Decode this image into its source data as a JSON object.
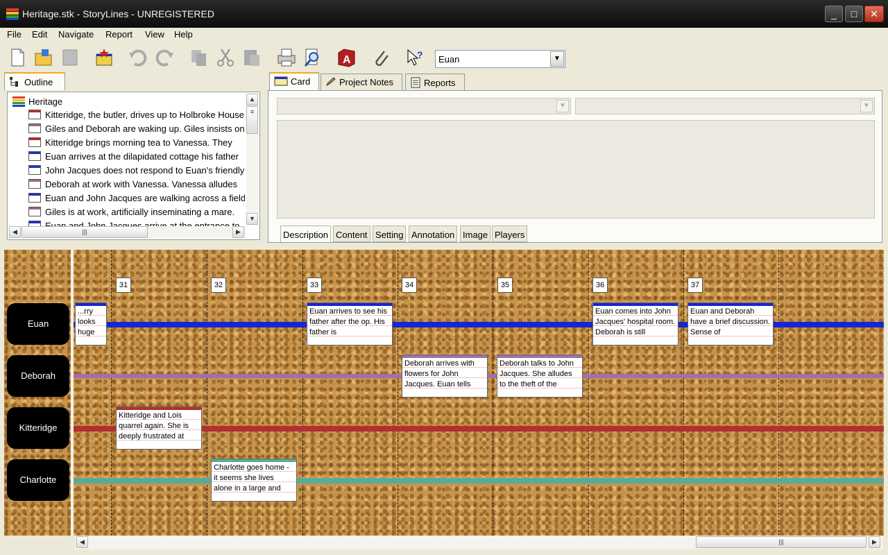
{
  "window": {
    "title": "Heritage.stk - StoryLines - UNREGISTERED",
    "minimize": "_",
    "maximize": "□",
    "close": "✕"
  },
  "menu": [
    "File",
    "Edit",
    "Navigate",
    "Report",
    "View",
    "Help"
  ],
  "toolbar": {
    "character_select": "Euan"
  },
  "outline": {
    "tab_label": "Outline",
    "root": "Heritage",
    "items": [
      {
        "text": "Kitteridge, the butler, drives up to Holbroke House",
        "color": "#b03030"
      },
      {
        "text": "Giles and Deborah are waking up.  Giles insists on",
        "color": "#9a6a8a"
      },
      {
        "text": "Kitteridge brings morning tea to Vanessa. They",
        "color": "#b03030"
      },
      {
        "text": "Euan arrives at the dilapidated cottage his father",
        "color": "#1f2fbf"
      },
      {
        "text": "John Jacques does not respond to Euan's friendly",
        "color": "#1f2fbf"
      },
      {
        "text": "Deborah at work with Vanessa. Vanessa alludes",
        "color": "#9a6a8a"
      },
      {
        "text": "Euan and John Jacques are walking across a field",
        "color": "#1f2fbf"
      },
      {
        "text": "Giles is at work, artificially inseminating a mare.",
        "color": "#9a6a8a"
      },
      {
        "text": "Euan and John Jacques arrive at the entrance to",
        "color": "#1f2fbf"
      }
    ]
  },
  "card_tabs": [
    "Card",
    "Project Notes",
    "Reports"
  ],
  "card_subtabs": [
    "Description",
    "Content",
    "Setting",
    "Annotation",
    "Image",
    "Players"
  ],
  "timeline": {
    "columns": [
      "31",
      "32",
      "33",
      "34",
      "35",
      "36",
      "37"
    ],
    "characters": [
      {
        "name": "Euan",
        "color": "#1326d6"
      },
      {
        "name": "Deborah",
        "color": "#a070a8"
      },
      {
        "name": "Kitteridge",
        "color": "#b03030"
      },
      {
        "name": "Charlotte",
        "color": "#5aaa9a"
      }
    ],
    "notes": [
      {
        "text": "...rry looks huge",
        "color": "#1326d6"
      },
      {
        "text": "Euan arrives to see his father after the op. His father is",
        "color": "#1326d6"
      },
      {
        "text": "Euan comes into John Jacques' hospital room. Deborah is still",
        "color": "#1326d6"
      },
      {
        "text": "Euan and Deborah have a brief discussion. Sense of",
        "color": "#1326d6"
      },
      {
        "text": "Deborah arrives with flowers for John Jacques. Euan tells",
        "color": "#a070a8"
      },
      {
        "text": "Deborah talks to John Jacques. She alludes to the theft of the",
        "color": "#a070a8"
      },
      {
        "text": "Kitteridge and Lois quarrel again. She is deeply frustrated at",
        "color": "#b03030"
      },
      {
        "text": "Charlotte goes home - it seems she lives alone in a large and",
        "color": "#5aaa9a"
      }
    ]
  }
}
